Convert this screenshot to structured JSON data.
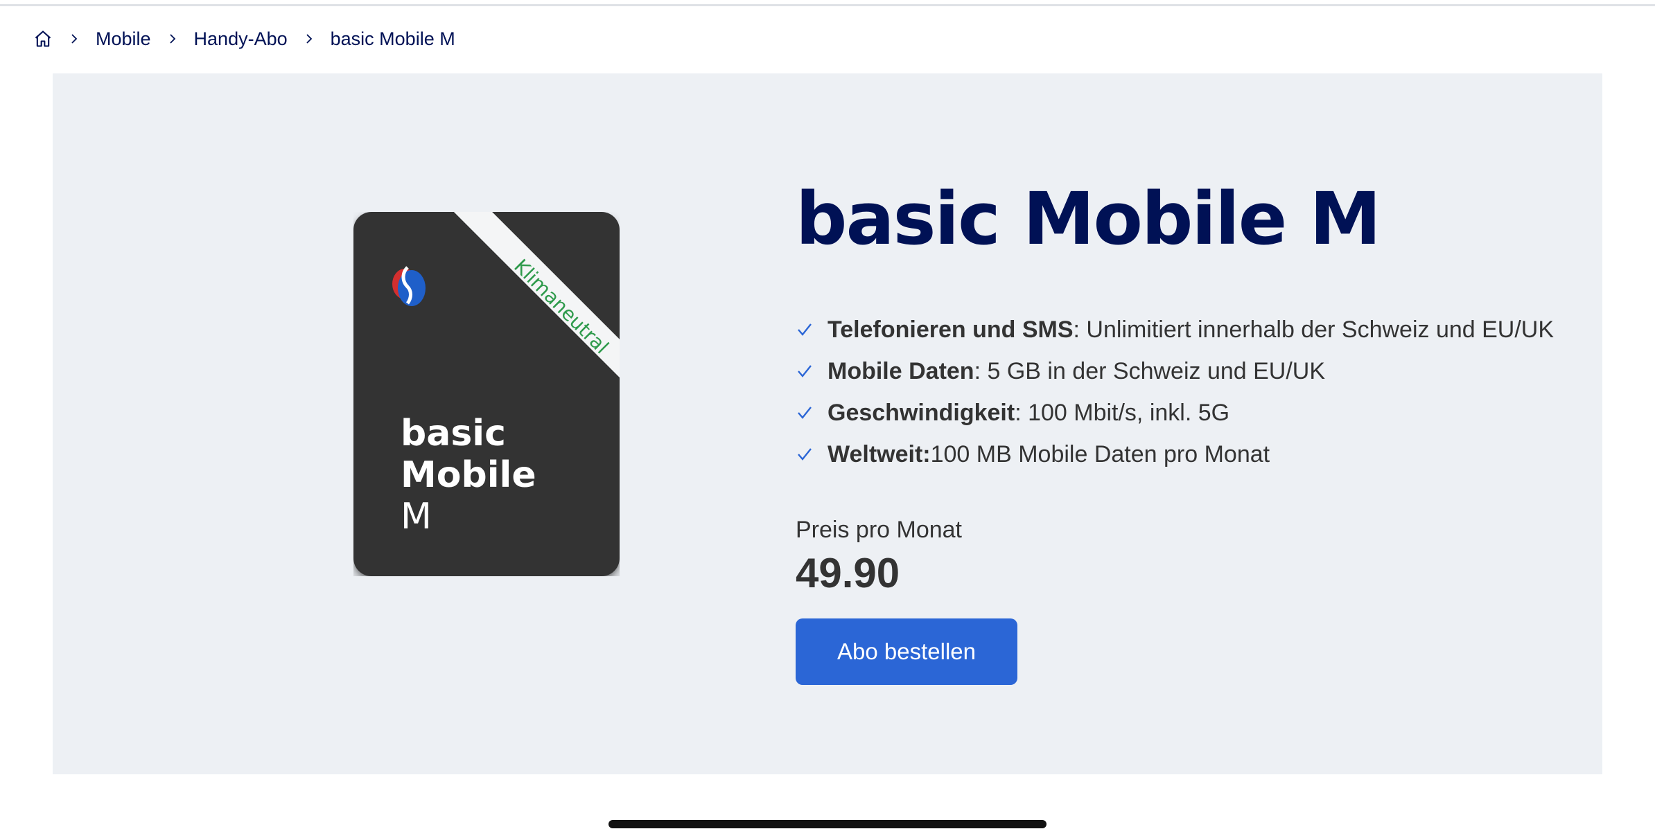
{
  "breadcrumb": {
    "home_icon": "home-icon",
    "items": [
      "Mobile",
      "Handy-Abo",
      "basic Mobile M"
    ]
  },
  "sim_card": {
    "ribbon": "Klimaneutral",
    "title_line1": "basic",
    "title_line2": "Mobile",
    "title_line3": "M",
    "logo_icon": "swisscom-logo-icon"
  },
  "product": {
    "title": "basic Mobile M",
    "features": [
      {
        "key": "Telefonieren und SMS",
        "value": ": Unlimitiert innerhalb der Schweiz und EU/UK"
      },
      {
        "key": "Mobile Daten",
        "value": ": 5 GB in der Schweiz und EU/UK"
      },
      {
        "key": "Geschwindigkeit",
        "value": ": 100 Mbit/s, inkl. 5G"
      },
      {
        "key": "Weltweit:",
        "value": " 100 MB Mobile Daten pro Monat"
      }
    ],
    "price_label": "Preis pro Monat",
    "price_value": "49.90",
    "order_button": "Abo bestellen"
  },
  "colors": {
    "brand_navy": "#001155",
    "accent_blue": "#2b66d6",
    "hero_bg": "#edf0f4",
    "ribbon_green": "#2e9a4b"
  }
}
